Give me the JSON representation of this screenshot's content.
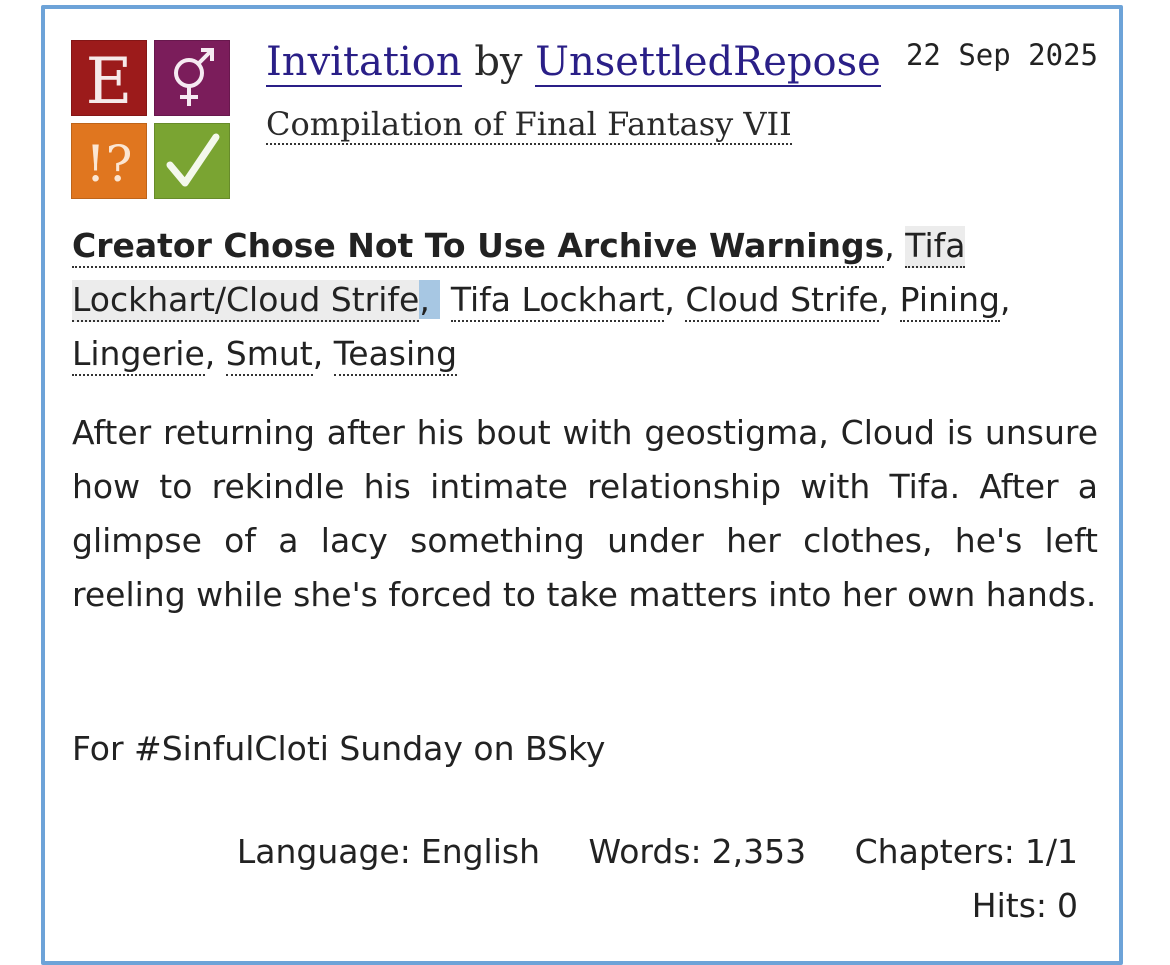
{
  "work": {
    "title": "Invitation",
    "by": "by",
    "author": "UnsettledRepose",
    "fandom": "Compilation of Final Fantasy VII",
    "date": "22 Sep 2025"
  },
  "required_tags": [
    {
      "symbol": "E",
      "icon": "rating-explicit-icon",
      "color": "#9c1b1b"
    },
    {
      "symbol": "♂♀",
      "icon": "category-multi-gender-icon",
      "color": "#7b1d5b"
    },
    {
      "symbol": "!?",
      "icon": "warning-choose-not-to-warn-icon",
      "color": "#e0761f"
    },
    {
      "symbol": "✓",
      "icon": "complete-work-checkmark-icon",
      "color": "#7aa432"
    }
  ],
  "tags": {
    "warning": "Creator Chose Not To Use Archive Warnings",
    "relationship": "Tifa Lockhart/Cloud Strife",
    "characters": [
      "Tifa Lockhart",
      "Cloud Strife"
    ],
    "freeforms": [
      "Pining",
      "Lingerie",
      "Smut",
      "Teasing"
    ],
    "separator": ","
  },
  "summary": "After returning after his bout with geostigma, Cloud is unsure how to rekindle his intimate relationship with Tifa. After a glimpse of a lacy something under her clothes, he's left reeling while she's forced to take matters into her own hands.",
  "note": "For #SinfulCloti Sunday on BSky",
  "stats": {
    "language_label": "Language:",
    "language": "English",
    "words_label": "Words:",
    "words": "2,353",
    "chapters_label": "Chapters:",
    "chapters": "1/1",
    "hits_label": "Hits:",
    "hits": "0"
  },
  "colors": {
    "border": "#6da3d8",
    "link": "#2a1f87",
    "selection": "#a7c7e3"
  }
}
